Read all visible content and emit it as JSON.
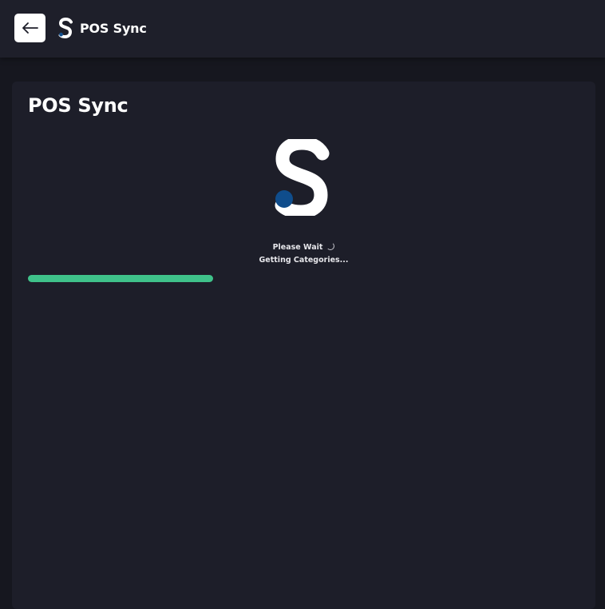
{
  "header": {
    "back_icon": "arrow-left-icon",
    "logo_icon": "s-logo-icon",
    "title": "POS Sync"
  },
  "main": {
    "title": "POS Sync",
    "logo_icon": "s-logo-icon",
    "status": {
      "line1": "Please Wait",
      "line2": "Getting Categories...",
      "spinner_icon": "spinner-icon"
    },
    "progress": {
      "fraction": 0.336,
      "color": "#3fc28a"
    }
  },
  "colors": {
    "background": "#16171f",
    "header": "#1e1f2a",
    "card": "#1d1e29",
    "accent_blue": "#0f4d8c",
    "progress": "#3fc28a"
  }
}
